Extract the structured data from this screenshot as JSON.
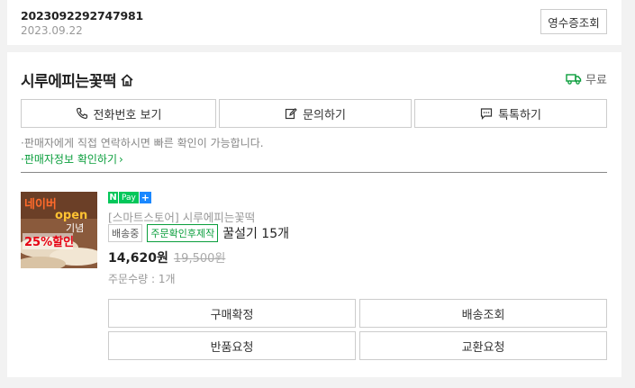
{
  "order": {
    "number": "2023092292747981",
    "date": "2023.09.22",
    "receipt_label": "영수증조회"
  },
  "store": {
    "name": "시루에피는꽃떡",
    "shipping_label": "무료"
  },
  "contact_buttons": {
    "phone": "전화번호 보기",
    "inquiry": "문의하기",
    "talktalk": "톡톡하기"
  },
  "notices": {
    "contact": "·판매자에게 직접 연락하시면 빠른 확인이 가능합니다.",
    "seller_info": "·판매자정보 확인하기"
  },
  "product": {
    "npay_n": "N",
    "npay_pay": "Pay",
    "npay_plus": "+",
    "store_line": "[스마트스토어] 시루에피는꽃떡",
    "status_badge": "배송중",
    "made_to_order_badge": "주문확인후제작",
    "title": "꿀설기 15개",
    "price": "14,620원",
    "original_price": "19,500원",
    "quantity": "주문수량 : 1개",
    "thumb_text": {
      "line1": "네이버",
      "line2": "open",
      "line3": "기념",
      "line4": "25%할인"
    }
  },
  "actions": {
    "confirm": "구매확정",
    "track": "배송조회",
    "return": "반품요청",
    "exchange": "교환요청"
  },
  "colors": {
    "accent_green": "#0a9e3c",
    "npay_green": "#03c75a",
    "npay_blue": "#1a88ff"
  }
}
